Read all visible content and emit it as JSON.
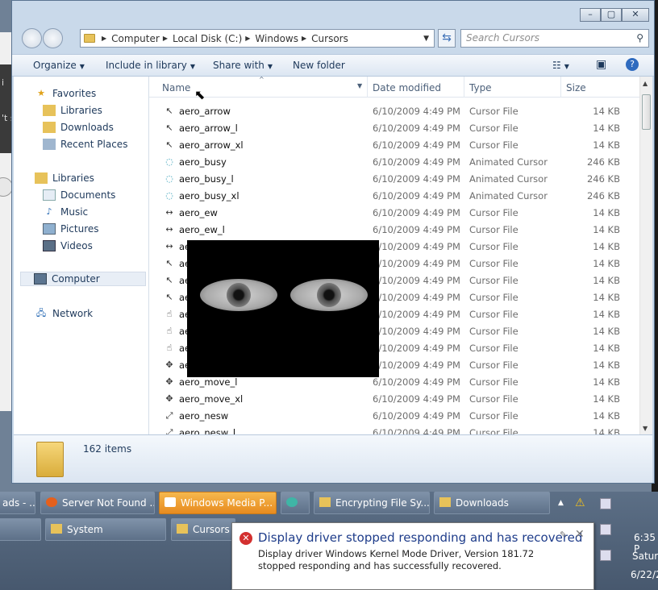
{
  "window": {
    "buttons": {
      "minimize": "–",
      "maximize": "▢",
      "close": "✕"
    }
  },
  "address": {
    "segments": [
      "Computer",
      "Local Disk (C:)",
      "Windows",
      "Cursors"
    ]
  },
  "search": {
    "placeholder": "Search Cursors"
  },
  "toolbar": {
    "organize": "Organize",
    "include": "Include in library",
    "share": "Share with",
    "newfolder": "New folder"
  },
  "nav": {
    "favorites": "Favorites",
    "libraries_fav": "Libraries",
    "downloads": "Downloads",
    "recent": "Recent Places",
    "libraries": "Libraries",
    "documents": "Documents",
    "music": "Music",
    "pictures": "Pictures",
    "videos": "Videos",
    "computer": "Computer",
    "network": "Network"
  },
  "columns": {
    "name": "Name",
    "date": "Date modified",
    "type": "Type",
    "size": "Size"
  },
  "files": [
    {
      "name": "aero_arrow",
      "date": "6/10/2009 4:49 PM",
      "type": "Cursor File",
      "size": "14 KB",
      "icon": "arrow-cursor-icon"
    },
    {
      "name": "aero_arrow_l",
      "date": "6/10/2009 4:49 PM",
      "type": "Cursor File",
      "size": "14 KB",
      "icon": "arrow-cursor-icon"
    },
    {
      "name": "aero_arrow_xl",
      "date": "6/10/2009 4:49 PM",
      "type": "Cursor File",
      "size": "14 KB",
      "icon": "arrow-cursor-icon"
    },
    {
      "name": "aero_busy",
      "date": "6/10/2009 4:49 PM",
      "type": "Animated Cursor",
      "size": "246 KB",
      "icon": "busy-cursor-icon"
    },
    {
      "name": "aero_busy_l",
      "date": "6/10/2009 4:49 PM",
      "type": "Animated Cursor",
      "size": "246 KB",
      "icon": "busy-cursor-icon"
    },
    {
      "name": "aero_busy_xl",
      "date": "6/10/2009 4:49 PM",
      "type": "Animated Cursor",
      "size": "246 KB",
      "icon": "busy-cursor-icon"
    },
    {
      "name": "aero_ew",
      "date": "6/10/2009 4:49 PM",
      "type": "Cursor File",
      "size": "14 KB",
      "icon": "resize-ew-cursor-icon"
    },
    {
      "name": "aero_ew_l",
      "date": "6/10/2009 4:49 PM",
      "type": "Cursor File",
      "size": "14 KB",
      "icon": "resize-ew-cursor-icon"
    },
    {
      "name": "ae",
      "date": "6/10/2009 4:49 PM",
      "type": "Cursor File",
      "size": "14 KB",
      "icon": "resize-ew-cursor-icon"
    },
    {
      "name": "ae",
      "date": "6/10/2009 4:49 PM",
      "type": "Cursor File",
      "size": "14 KB",
      "icon": "help-cursor-icon"
    },
    {
      "name": "ae",
      "date": "6/10/2009 4:49 PM",
      "type": "Cursor File",
      "size": "14 KB",
      "icon": "help-cursor-icon"
    },
    {
      "name": "ae",
      "date": "6/10/2009 4:49 PM",
      "type": "Cursor File",
      "size": "14 KB",
      "icon": "help-cursor-icon"
    },
    {
      "name": "ae",
      "date": "6/10/2009 4:49 PM",
      "type": "Cursor File",
      "size": "14 KB",
      "icon": "hand-cursor-icon"
    },
    {
      "name": "ae",
      "date": "6/10/2009 4:49 PM",
      "type": "Cursor File",
      "size": "14 KB",
      "icon": "hand-cursor-icon"
    },
    {
      "name": "ae",
      "date": "6/10/2009 4:49 PM",
      "type": "Cursor File",
      "size": "14 KB",
      "icon": "hand-cursor-icon"
    },
    {
      "name": "aero",
      "date": "6/10/2009 4:49 PM",
      "type": "Cursor File",
      "size": "14 KB",
      "icon": "move-cursor-icon"
    },
    {
      "name": "aero_move_l",
      "date": "6/10/2009 4:49 PM",
      "type": "Cursor File",
      "size": "14 KB",
      "icon": "move-cursor-icon"
    },
    {
      "name": "aero_move_xl",
      "date": "6/10/2009 4:49 PM",
      "type": "Cursor File",
      "size": "14 KB",
      "icon": "move-cursor-icon"
    },
    {
      "name": "aero_nesw",
      "date": "6/10/2009 4:49 PM",
      "type": "Cursor File",
      "size": "14 KB",
      "icon": "resize-nesw-cursor-icon"
    },
    {
      "name": "aero_nesw_l",
      "date": "6/10/2009 4:49 PM",
      "type": "Cursor File",
      "size": "14 KB",
      "icon": "resize-nesw-cursor-icon"
    }
  ],
  "details": {
    "count": "162 items"
  },
  "taskbar": {
    "row1": [
      {
        "label": "ads - ...",
        "active": false
      },
      {
        "label": "Server Not Found ...",
        "active": false
      },
      {
        "label": "Windows Media P...",
        "active": true
      },
      {
        "label": "",
        "active": false
      },
      {
        "label": "Encrypting File Sy...",
        "active": false
      },
      {
        "label": "Downloads",
        "active": false
      }
    ],
    "row2": [
      {
        "label": "System"
      },
      {
        "label": "Cursors"
      }
    ],
    "clock": {
      "time": "6:35 P",
      "day": "Saturd",
      "date": "6/22/2"
    }
  },
  "balloon": {
    "title": "Display driver stopped responding and has recovered",
    "body": "Display driver Windows Kernel Mode Driver, Version 181.72 stopped responding and has successfully recovered."
  },
  "bg_window": {
    "lines": [
      "i",
      "'t s"
    ]
  },
  "colors": {
    "accent": "#1e395b",
    "active_task": "#e78b1f",
    "error": "#d3302f"
  }
}
